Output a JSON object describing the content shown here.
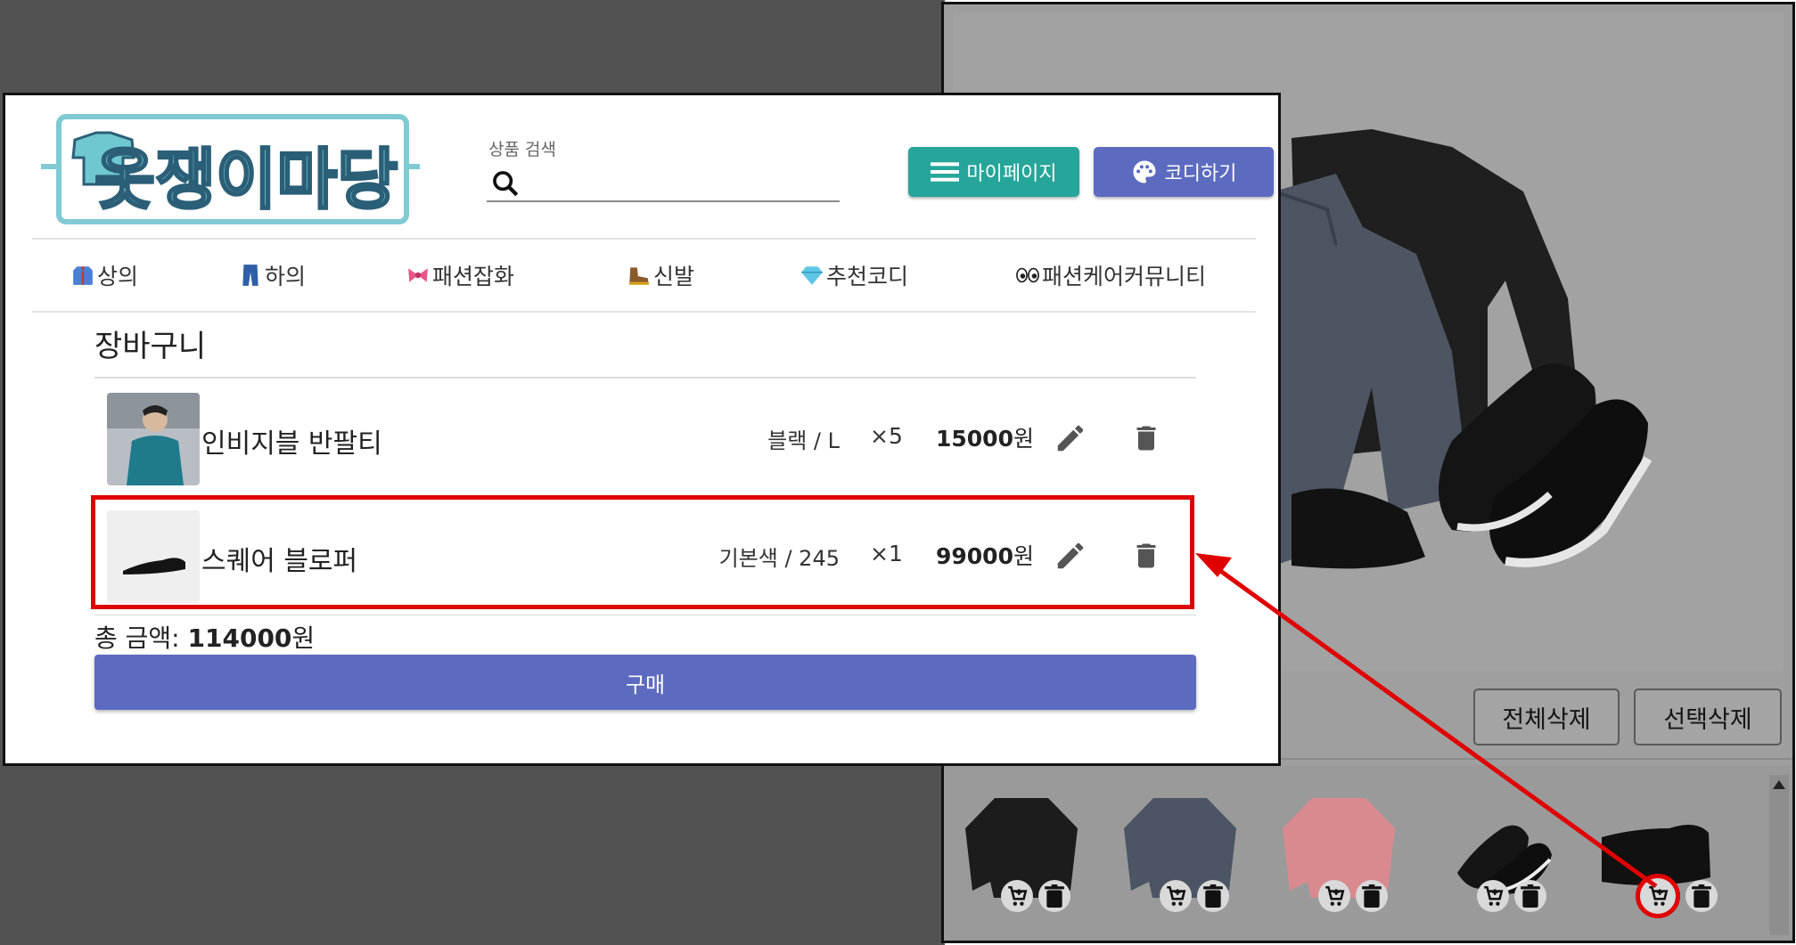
{
  "header": {
    "logo_text": "옷쟁이마당",
    "search_label": "상품 검색",
    "search_value": "",
    "mypage_label": "마이페이지",
    "coordi_label": "코디하기"
  },
  "nav": {
    "items": [
      {
        "label": "상의",
        "icon": "shirt-icon"
      },
      {
        "label": "하의",
        "icon": "jeans-icon"
      },
      {
        "label": "패션잡화",
        "icon": "ribbon-icon"
      },
      {
        "label": "신발",
        "icon": "boot-icon"
      },
      {
        "label": "추천코디",
        "icon": "gem-icon"
      },
      {
        "label": "패션케어커뮤니티",
        "icon": "eyes-icon"
      }
    ]
  },
  "cart": {
    "title": "장바구니",
    "items": [
      {
        "name": "인비지블 반팔티",
        "option": "블랙 / L",
        "qty": "×5",
        "price": "15000",
        "unit": "원"
      },
      {
        "name": "스퀘어 블로퍼",
        "option": "기본색 / 245",
        "qty": "×1",
        "price": "99000",
        "unit": "원"
      }
    ],
    "total_label": "총 금액: ",
    "total_amount": "114000",
    "total_unit": "원",
    "buy_label": "구매"
  },
  "coordi": {
    "delete_all_label": "전체삭제",
    "delete_selected_label": "선택삭제",
    "thumbnails": [
      {
        "name": "black-sweatshirt",
        "color": "#1c1c1c"
      },
      {
        "name": "navy-tiedye-sweatshirt",
        "color": "#4b5563"
      },
      {
        "name": "pink-tiedye-sweatshirt",
        "color": "#d98a8f"
      },
      {
        "name": "black-sneakers",
        "color": "#151515"
      },
      {
        "name": "black-loafer",
        "color": "#111111"
      }
    ]
  },
  "colors": {
    "accent_teal": "#26a69a",
    "accent_indigo": "#5c6bc0",
    "annotation_red": "#e00000"
  }
}
